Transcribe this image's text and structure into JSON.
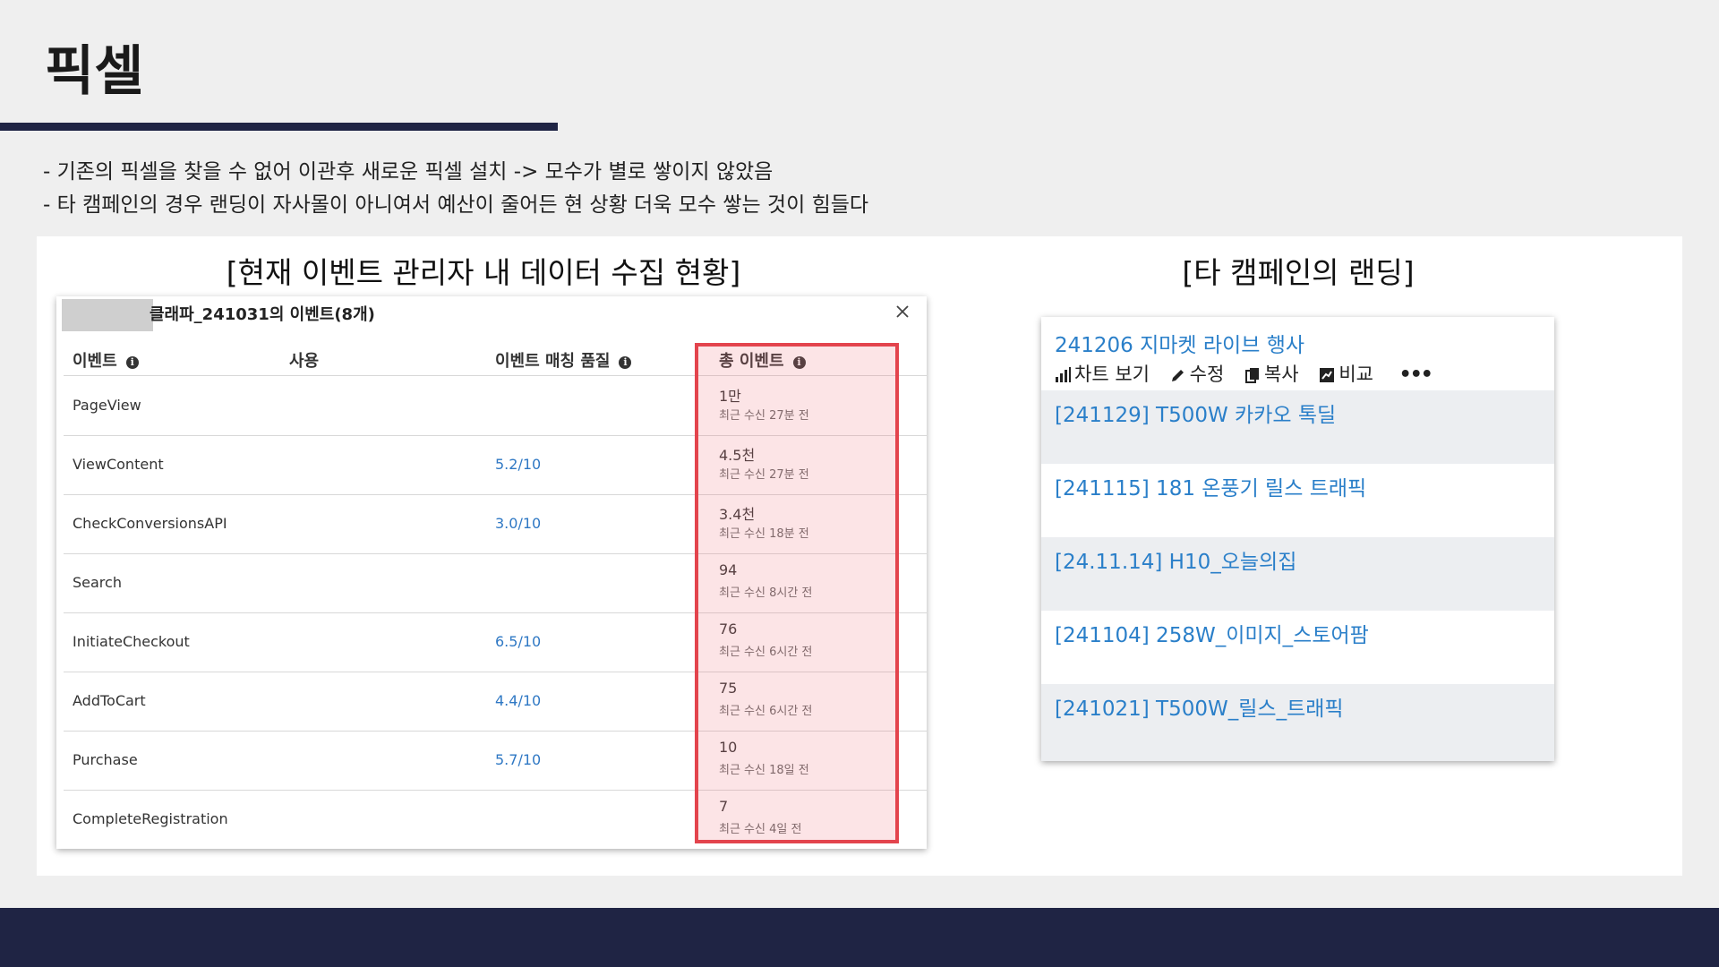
{
  "slide": {
    "title": "픽셀",
    "bullets": [
      "- 기존의 픽셀을 찾을 수 없어 이관후 새로운 픽셀 설치 -> 모수가 별로 쌓이지 않았음",
      "- 타 캠페인의 경우 랜딩이 자사몰이 아니여서 예산이 줄어든 현 상황 더욱 모수 쌓는 것이 힘들다"
    ],
    "left_heading": "[현재 이벤트 관리자 내 데이터 수집 현황]",
    "right_heading": "[타 캠페인의 랜딩]"
  },
  "events_dialog": {
    "title": "클래파_241031의 이벤트(8개)",
    "columns": {
      "event": "이벤트",
      "usage": "사용",
      "quality": "이벤트 매칭 품질",
      "total": "총 이벤트"
    },
    "rows": [
      {
        "event": "PageView",
        "quality": "",
        "total": "1만",
        "recent": "최근 수신 27분 전"
      },
      {
        "event": "ViewContent",
        "quality": "5.2/10",
        "total": "4.5천",
        "recent": "최근 수신 27분 전"
      },
      {
        "event": "CheckConversionsAPI",
        "quality": "3.0/10",
        "total": "3.4천",
        "recent": "최근 수신 18분 전"
      },
      {
        "event": "Search",
        "quality": "",
        "total": "94",
        "recent": "최근 수신 8시간 전"
      },
      {
        "event": "InitiateCheckout",
        "quality": "6.5/10",
        "total": "76",
        "recent": "최근 수신 6시간 전"
      },
      {
        "event": "AddToCart",
        "quality": "4.4/10",
        "total": "75",
        "recent": "최근 수신 6시간 전"
      },
      {
        "event": "Purchase",
        "quality": "5.7/10",
        "total": "10",
        "recent": "최근 수신 18일 전"
      },
      {
        "event": "CompleteRegistration",
        "quality": "",
        "total": "7",
        "recent": "최근 수신 4일 전"
      }
    ]
  },
  "landing": {
    "items": [
      "241206 지마켓 라이브 행사",
      "[241129] T500W 카카오 톡딜",
      "[241115] 181 온풍기 릴스 트래픽",
      "[24.11.14] H10_오늘의집",
      "[241104] 258W_이미지_스토어팜",
      "[241021] T500W_릴스_트래픽"
    ],
    "actions": {
      "chart": "차트 보기",
      "edit": "수정",
      "copy": "복사",
      "compare": "비교"
    }
  },
  "colors": {
    "navy": "#1f2444",
    "link": "#2a7fc9",
    "highlight_border": "#e3444d"
  }
}
